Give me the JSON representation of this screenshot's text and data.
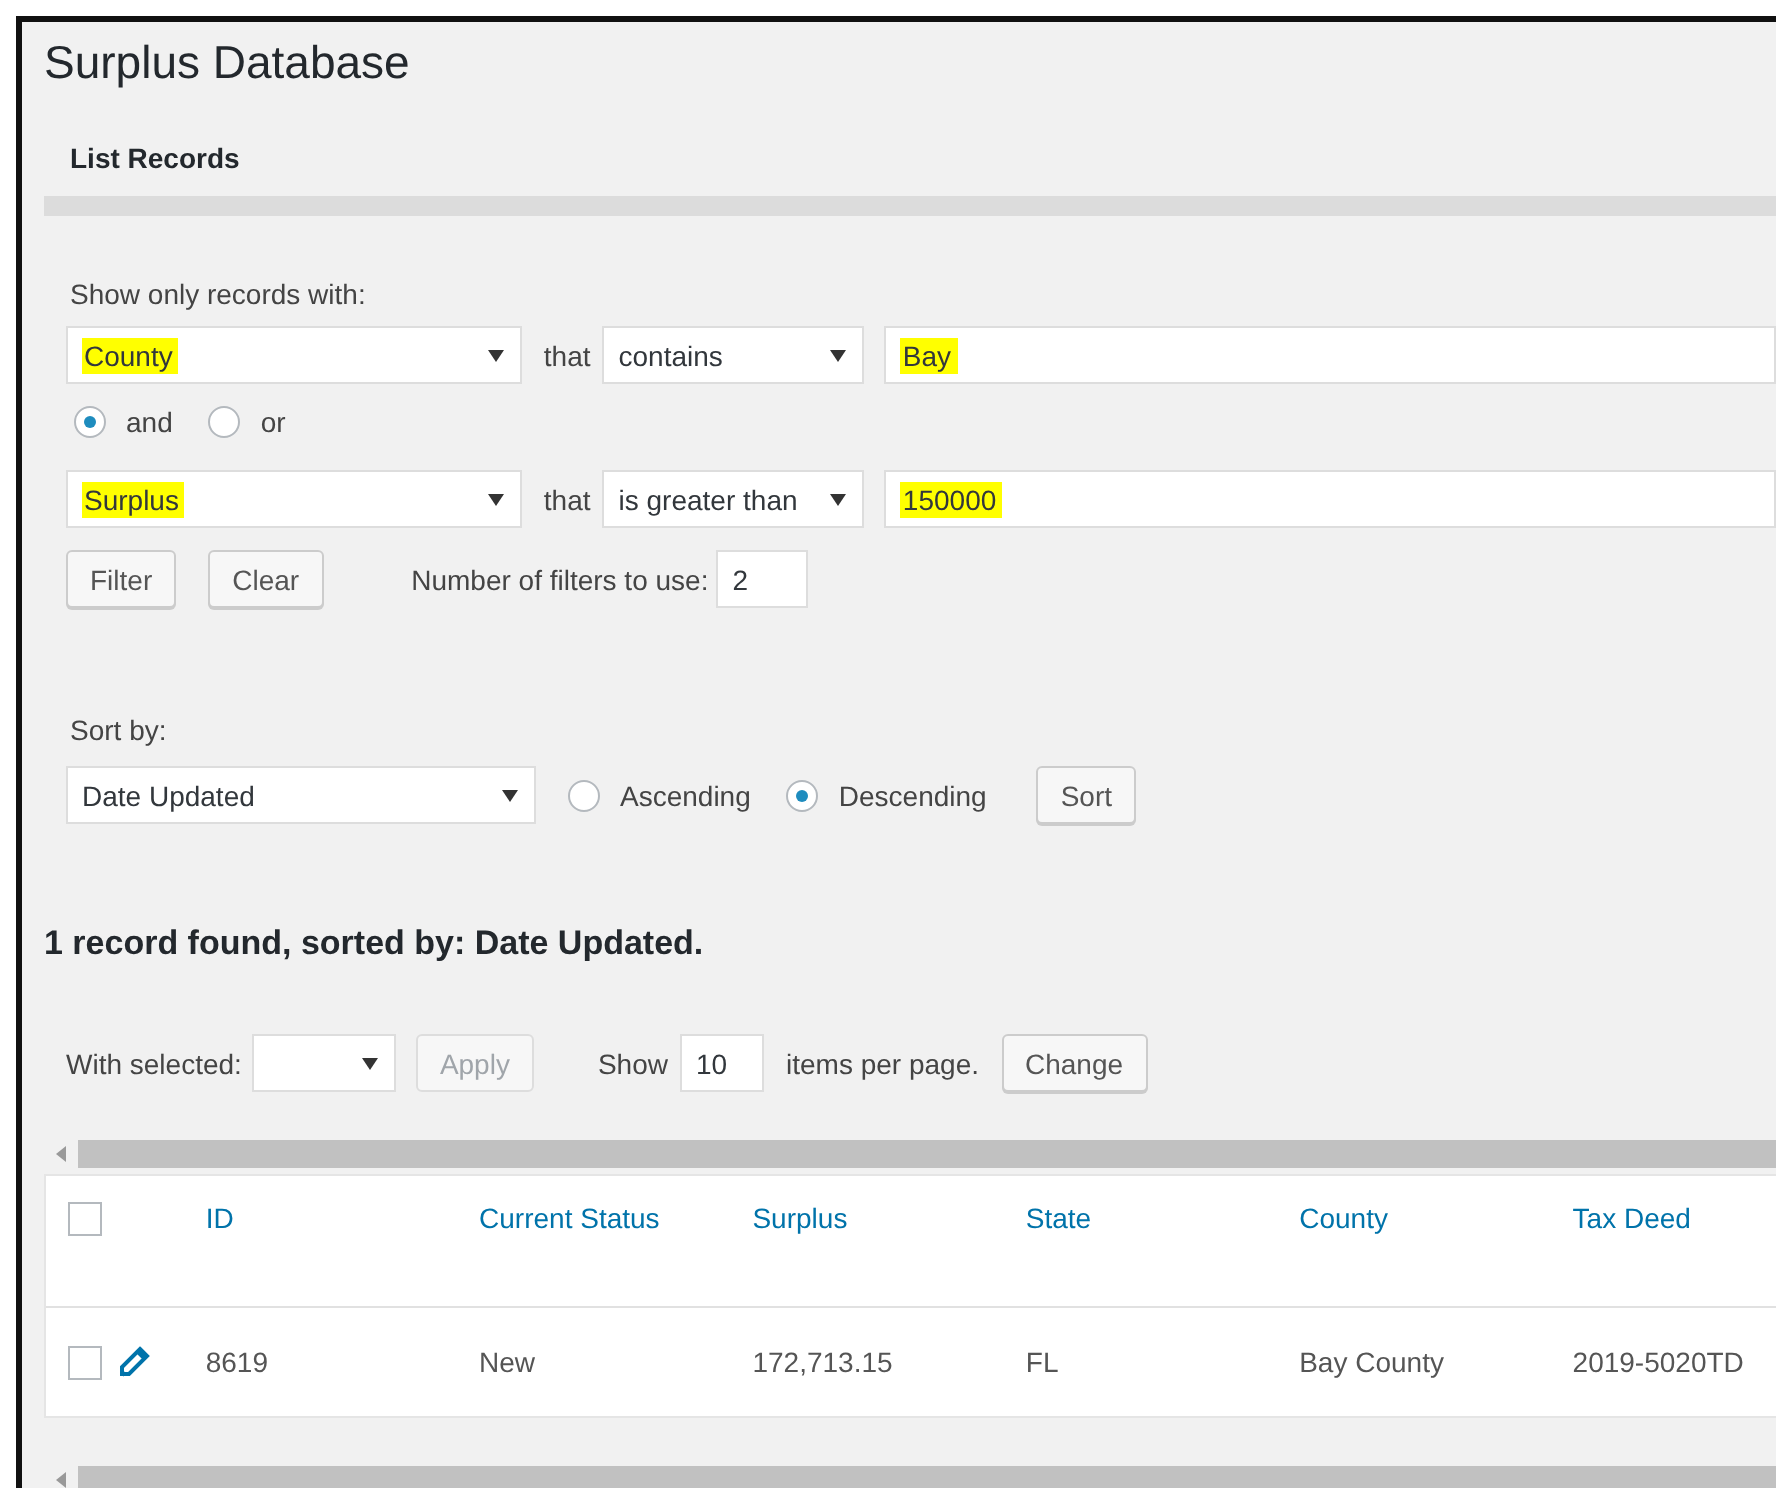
{
  "page": {
    "title": "Surplus Database",
    "subtitle": "List Records"
  },
  "filter": {
    "label": "Show only records with:",
    "rows": [
      {
        "field": "County",
        "field_highlighted": true,
        "connector": "that",
        "operator": "contains",
        "value": "Bay",
        "value_highlighted": true
      },
      {
        "field": "Surplus",
        "field_highlighted": true,
        "connector": "that",
        "operator": "is greater than",
        "value": "150000",
        "value_highlighted": true
      }
    ],
    "logic": [
      {
        "label": "and",
        "selected": true
      },
      {
        "label": "or",
        "selected": false
      }
    ],
    "buttons": [
      "Filter",
      "Clear"
    ],
    "count_label": "Number of filters to use:",
    "count": "2"
  },
  "sort": {
    "label": "Sort by:",
    "field": "Date Updated",
    "directions": [
      {
        "label": "Ascending",
        "selected": false
      },
      {
        "label": "Descending",
        "selected": true
      }
    ],
    "button": "Sort"
  },
  "summary": "1 record found, sorted by: Date Updated.",
  "bulk": {
    "label": "With selected:",
    "apply": "Apply",
    "apply_disabled": true,
    "show_label": "Show",
    "per_page": "10",
    "per_page_label": "items per page.",
    "change": "Change"
  },
  "table": {
    "columns": [
      "ID",
      "Current Status",
      "Surplus",
      "State",
      "County",
      "Tax Deed"
    ],
    "header_checked": false,
    "rows": [
      {
        "checked": false,
        "cells": [
          "8619",
          "New",
          "172,713.15",
          "FL",
          "Bay County",
          "2019-5020TD"
        ]
      }
    ]
  }
}
